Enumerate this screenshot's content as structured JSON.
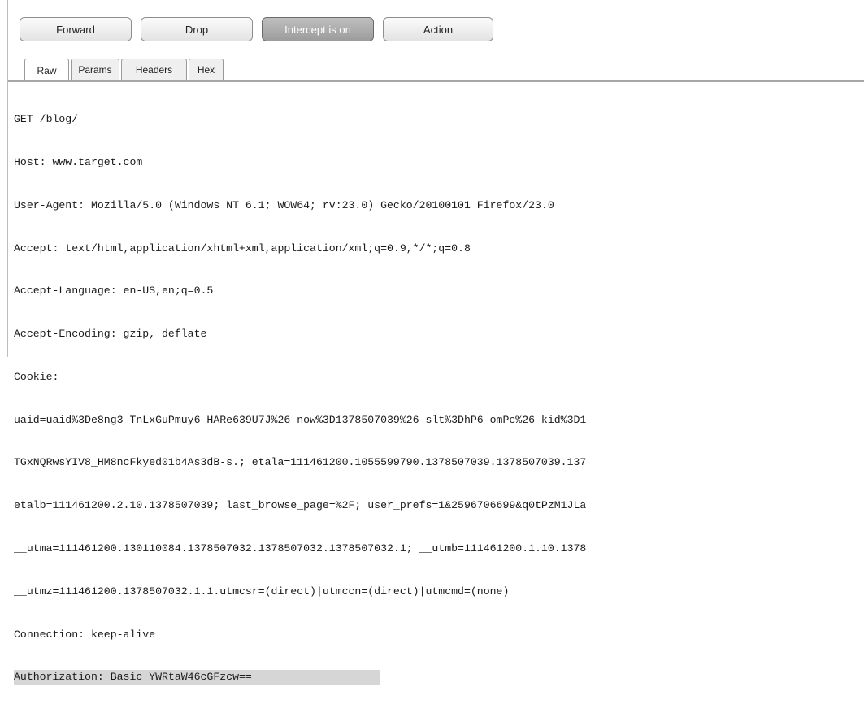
{
  "toolbar": {
    "forward_label": "Forward",
    "drop_label": "Drop",
    "intercept_label": "Intercept is on",
    "action_label": "Action"
  },
  "tabs": [
    {
      "label": "Raw",
      "active": true
    },
    {
      "label": "Params",
      "active": false
    },
    {
      "label": "Headers",
      "active": false
    },
    {
      "label": "Hex",
      "active": false
    }
  ],
  "request": {
    "lines": [
      "GET /blog/",
      "Host: www.target.com",
      "User-Agent: Mozilla/5.0 (Windows NT 6.1; WOW64; rv:23.0) Gecko/20100101 Firefox/23.0",
      "Accept: text/html,application/xhtml+xml,application/xml;q=0.9,*/*;q=0.8",
      "Accept-Language: en-US,en;q=0.5",
      "Accept-Encoding: gzip, deflate",
      "Cookie:",
      "uaid=uaid%3De8ng3-TnLxGuPmuy6-HARe639U7J%26_now%3D1378507039%26_slt%3DhP6-omPc%26_kid%3D1",
      "TGxNQRwsYIV8_HM8ncFkyed01b4As3dB-s.; etala=111461200.1055599790.1378507039.1378507039.137",
      "etalb=111461200.2.10.1378507039; last_browse_page=%2F; user_prefs=1&2596706699&q0tPzM1JLa",
      "__utma=111461200.130110084.1378507032.1378507032.1378507032.1; __utmb=111461200.1.10.1378",
      "__utmz=111461200.1378507032.1.1.utmcsr=(direct)|utmccn=(direct)|utmcmd=(none)",
      "Connection: keep-alive",
      "Authorization: Basic YWRtaW46cGFzcw=="
    ],
    "highlighted_line": "Authorization: Basic YWRtaW46cGFzcw=="
  }
}
